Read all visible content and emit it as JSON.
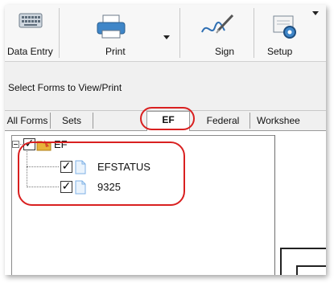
{
  "toolbar": {
    "data_entry_label": "Data Entry",
    "print_label": "Print",
    "sign_label": "Sign",
    "setup_label": "Setup"
  },
  "select_bar": {
    "label": "Select Forms to View/Print"
  },
  "tabs": {
    "all_forms": "All Forms",
    "sets": "Sets",
    "ef": "EF",
    "federal": "Federal",
    "worksheets": "Workshee"
  },
  "tree": {
    "root": {
      "label": "EF",
      "checked": true
    },
    "children": [
      {
        "label": "EFSTATUS",
        "checked": true
      },
      {
        "label": "9325",
        "checked": true
      }
    ],
    "check_glyph": "✓"
  },
  "colors": {
    "highlight": "#d92020",
    "folder": "#e8b23a",
    "doc": "#7fb2e6"
  }
}
